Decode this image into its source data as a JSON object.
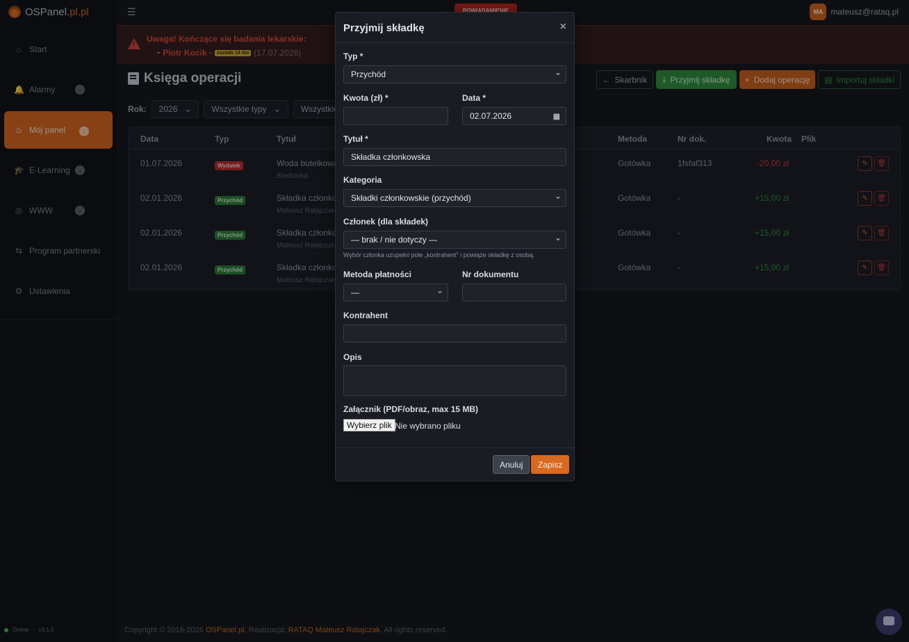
{
  "app": {
    "logo_main": "OSPanel.",
    "logo_tld": "pl.pl"
  },
  "sidebar": {
    "items": [
      {
        "label": "Start",
        "icon": "home-icon",
        "glyph": "⌂",
        "expand": false
      },
      {
        "label": "Alarmy",
        "icon": "bell-icon",
        "glyph": "🔔",
        "expand": true
      },
      {
        "label": "Mój panel",
        "icon": "firefighter-icon",
        "glyph": "♨",
        "expand": true,
        "active": true
      },
      {
        "label": "E-Learning",
        "icon": "graduation-cap-icon",
        "glyph": "🎓",
        "expand": true
      },
      {
        "label": "WWW",
        "icon": "globe-icon",
        "glyph": "◎",
        "expand": true
      },
      {
        "label": "Program partnerski",
        "icon": "handshake-icon",
        "glyph": "⇆",
        "expand": false
      },
      {
        "label": "Ustawienia",
        "icon": "gear-icon",
        "glyph": "⚙",
        "expand": false
      }
    ],
    "status": "Online",
    "version": "v3.1.0"
  },
  "topbar": {
    "notification": "POWIADAMIENIE",
    "user_initials": "MA",
    "user_email": "mateusz@rataq.pl"
  },
  "alert": {
    "title": "Uwaga! Kończące się badania lekarskie:",
    "person": "Piotr Kocik -",
    "remaining": "zostało 14 dni",
    "date": "(17.07.2026)"
  },
  "page": {
    "title": "Księga operacji"
  },
  "filters": {
    "year_label": "Rok:",
    "year": "2026",
    "types": "Wszystkie typy",
    "categories": "Wszystkie kateg"
  },
  "actions": {
    "treasurer": "Skarbnik",
    "accept_fee": "Przyjmij składkę",
    "add_operation": "Dodaj operację",
    "import_fees": "Importuj składki"
  },
  "table": {
    "headers": {
      "date": "Data",
      "type": "Typ",
      "title": "Tytuł",
      "method": "Metoda",
      "doc": "Nr dok.",
      "amount": "Kwota",
      "file": "Plik"
    },
    "rows": [
      {
        "date": "01.07.2026",
        "type": "Wydatek",
        "title": "Woda butelkowa",
        "sub": "Biedronka",
        "method": "Gotówka",
        "doc": "1fsfaf313",
        "amount": "-20,00 zł",
        "kind": "neg"
      },
      {
        "date": "02.01.2026",
        "type": "Przychód",
        "title": "Składka członkow",
        "sub": "Mateusz Ratajczak",
        "method": "Gotówka",
        "doc": "-",
        "amount": "+15,00 zł",
        "kind": "pos"
      },
      {
        "date": "02.01.2026",
        "type": "Przychód",
        "title": "Składka członkow",
        "sub": "Mateusz Ratajczak",
        "method": "Gotówka",
        "doc": "-",
        "amount": "+15,00 zł",
        "kind": "pos"
      },
      {
        "date": "02.01.2026",
        "type": "Przychód",
        "title": "Składka członkow",
        "sub": "Mateusz Ratajczak",
        "method": "Gotówka",
        "doc": "-",
        "amount": "+15,00 zł",
        "kind": "pos"
      }
    ]
  },
  "footer": {
    "prefix": "Copyright © 2016-2026 ",
    "brand": "OSPanel.pl",
    "mid": ". Realizacja: ",
    "author": "RATAQ Mateusz Ratajczak",
    "suffix": ". All rights reserved."
  },
  "modal": {
    "title": "Przyjmij składkę",
    "type_label": "Typ *",
    "type_value": "Przychód",
    "amount_label": "Kwota (zł) *",
    "amount_value": "",
    "date_label": "Data *",
    "date_value": "02.07.2026",
    "title_label": "Tytuł *",
    "title_value": "Składka członkowska",
    "category_label": "Kategoria",
    "category_value": "Składki członkowskie (przychód)",
    "member_label": "Członek (dla składek)",
    "member_value": "— brak / nie dotyczy —",
    "member_help": "Wybór członka uzupełni pole „kontrahent\" i powiąże składkę z osobą.",
    "method_label": "Metoda płatności",
    "method_value": "—",
    "docnum_label": "Nr dokumentu",
    "docnum_value": "",
    "contractor_label": "Kontrahent",
    "contractor_value": "",
    "desc_label": "Opis",
    "desc_value": "",
    "attachment_label": "Załącznik (PDF/obraz, max 15 MB)",
    "file_button": "Wybierz plik",
    "file_status": "Nie wybrano pliku",
    "cancel": "Anuluj",
    "save": "Zapisz"
  }
}
